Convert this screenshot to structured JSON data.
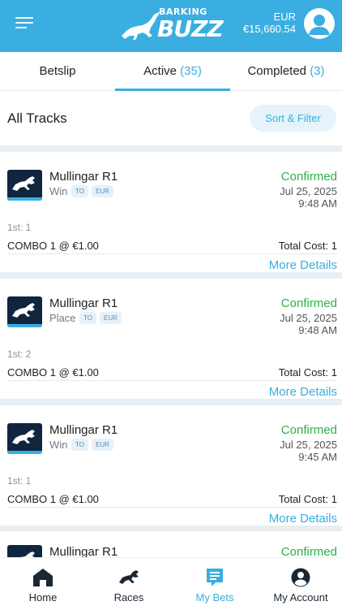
{
  "header": {
    "logo_top": "BARKING",
    "logo_main": "BUZZ",
    "currency": "EUR",
    "balance": "€15,660.54",
    "colors": {
      "brand": "#3aaee0",
      "confirmed": "#2db04b",
      "dark": "#0f2540"
    }
  },
  "tabs": [
    {
      "label": "Betslip",
      "count": ""
    },
    {
      "label": "Active",
      "count": "(35)"
    },
    {
      "label": "Completed",
      "count": "(3)"
    }
  ],
  "filter": {
    "title": "All Tracks",
    "sort_label": "Sort & Filter"
  },
  "bets": [
    {
      "race": "Mullingar R1",
      "type": "Win",
      "badge1": "TO",
      "badge2": "EUR",
      "status": "Confirmed",
      "date": "Jul 25, 2025",
      "time": "9:48 AM",
      "place": "1st: 1",
      "combo": "COMBO 1 @ €1.00",
      "cost": "Total Cost: 1",
      "more": "More Details"
    },
    {
      "race": "Mullingar R1",
      "type": "Place",
      "badge1": "TO",
      "badge2": "EUR",
      "status": "Confirmed",
      "date": "Jul 25, 2025",
      "time": "9:48 AM",
      "place": "1st: 2",
      "combo": "COMBO 1 @ €1.00",
      "cost": "Total Cost: 1",
      "more": "More Details"
    },
    {
      "race": "Mullingar R1",
      "type": "Win",
      "badge1": "TO",
      "badge2": "EUR",
      "status": "Confirmed",
      "date": "Jul 25, 2025",
      "time": "9:45 AM",
      "place": "1st: 1",
      "combo": "COMBO 1 @ €1.00",
      "cost": "Total Cost: 1",
      "more": "More Details"
    },
    {
      "race": "Mullingar R1",
      "status": "Confirmed"
    }
  ],
  "nav": [
    {
      "label": "Home",
      "icon": "home-icon"
    },
    {
      "label": "Races",
      "icon": "greyhound-icon"
    },
    {
      "label": "My Bets",
      "icon": "betslip-icon"
    },
    {
      "label": "My Account",
      "icon": "account-icon"
    }
  ]
}
